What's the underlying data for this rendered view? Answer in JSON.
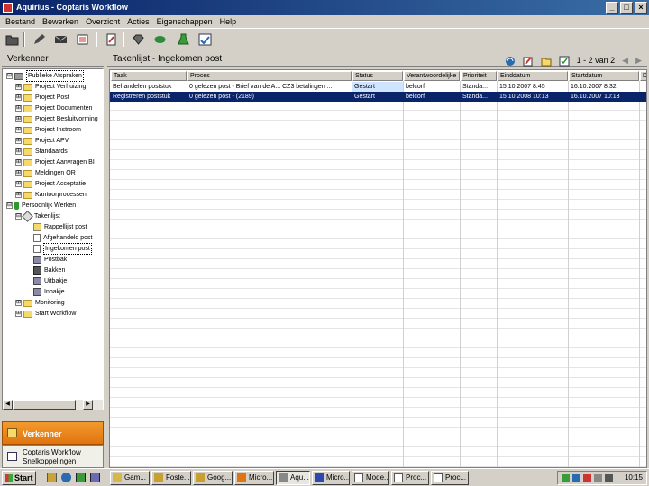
{
  "window": {
    "title": "Aquirius - Coptaris Workflow",
    "minimize": "_",
    "maximize": "□",
    "close": "×"
  },
  "menu": [
    "Bestand",
    "Bewerken",
    "Overzicht",
    "Acties",
    "Eigenschappen",
    "Help"
  ],
  "left_pane": {
    "title": "Verkenner",
    "tree": [
      {
        "label": "Publieke Afspraken",
        "expander": "⊟"
      },
      {
        "label": "Project Verhuizing",
        "expander": "⊞"
      },
      {
        "label": "Project Post",
        "expander": "⊞"
      },
      {
        "label": "Project Documenten",
        "expander": "⊞"
      },
      {
        "label": "Project Besluitvorming",
        "expander": "⊞"
      },
      {
        "label": "Project Instroom",
        "expander": "⊞"
      },
      {
        "label": "Project APV",
        "expander": "⊞"
      },
      {
        "label": "Standaards",
        "expander": "⊞"
      },
      {
        "label": "Project Aanvragen BI",
        "expander": "⊞"
      },
      {
        "label": "Meldingen OR",
        "expander": "⊞"
      },
      {
        "label": "Project Acceptatie",
        "expander": "⊞"
      },
      {
        "label": "Kantoorprocessen",
        "expander": "⊞"
      },
      {
        "label": "Persoonlijk Werken",
        "expander": "⊟"
      },
      {
        "label": "Takenlijst",
        "expander": "⊟"
      },
      {
        "label": "Rappellijst post"
      },
      {
        "label": "Afgehandeld post"
      },
      {
        "label": "Ingekomen post"
      },
      {
        "label": "Postbak"
      },
      {
        "label": "Bakken"
      },
      {
        "label": "Uitbakje"
      },
      {
        "label": "Inbakje"
      },
      {
        "label": "Monitoring",
        "expander": "⊞"
      },
      {
        "label": "Start Workflow",
        "expander": "⊞"
      }
    ],
    "nav_verkenner": "Verkenner",
    "nav_snel_line1": "Coptaris Workflow",
    "nav_snel_line2": "Snelkoppelingen"
  },
  "right_pane": {
    "title": "Takenlijst - Ingekomen post",
    "paging": "1 - 2 van 2",
    "columns": [
      "Taak",
      "Proces",
      "Status",
      "Verantwoordelijke",
      "Prioriteit",
      "Einddatum",
      "Startdatum",
      "D"
    ],
    "rows": [
      [
        "Behandelen poststuk",
        "0 gelezen post - Brief van de A... CZ3 betalingen ...",
        "Gestart",
        "belcorf",
        "Standa...",
        "15.10.2007 8:45",
        "16.10.2007 8:32",
        ""
      ],
      [
        "Registreren poststuk",
        "0 gelezen post - (2189)",
        "Gestart",
        "belcorf",
        "Standa...",
        "15.10.2008 10:13",
        "16.10.2007 10:13",
        ""
      ]
    ]
  },
  "taskbar": {
    "start": "Start",
    "tasks": [
      "Gam...",
      "Foste...",
      "Goog...",
      "Micro...",
      "Aqu...",
      "Micro...",
      "Mode...",
      "Proc...",
      "Proc..."
    ],
    "active_task_index": 4,
    "clock": "10:15"
  },
  "colors": {
    "selection": "#0a246a",
    "title_gradient_start": "#0a246a",
    "accent_orange": "#f39a2d"
  }
}
